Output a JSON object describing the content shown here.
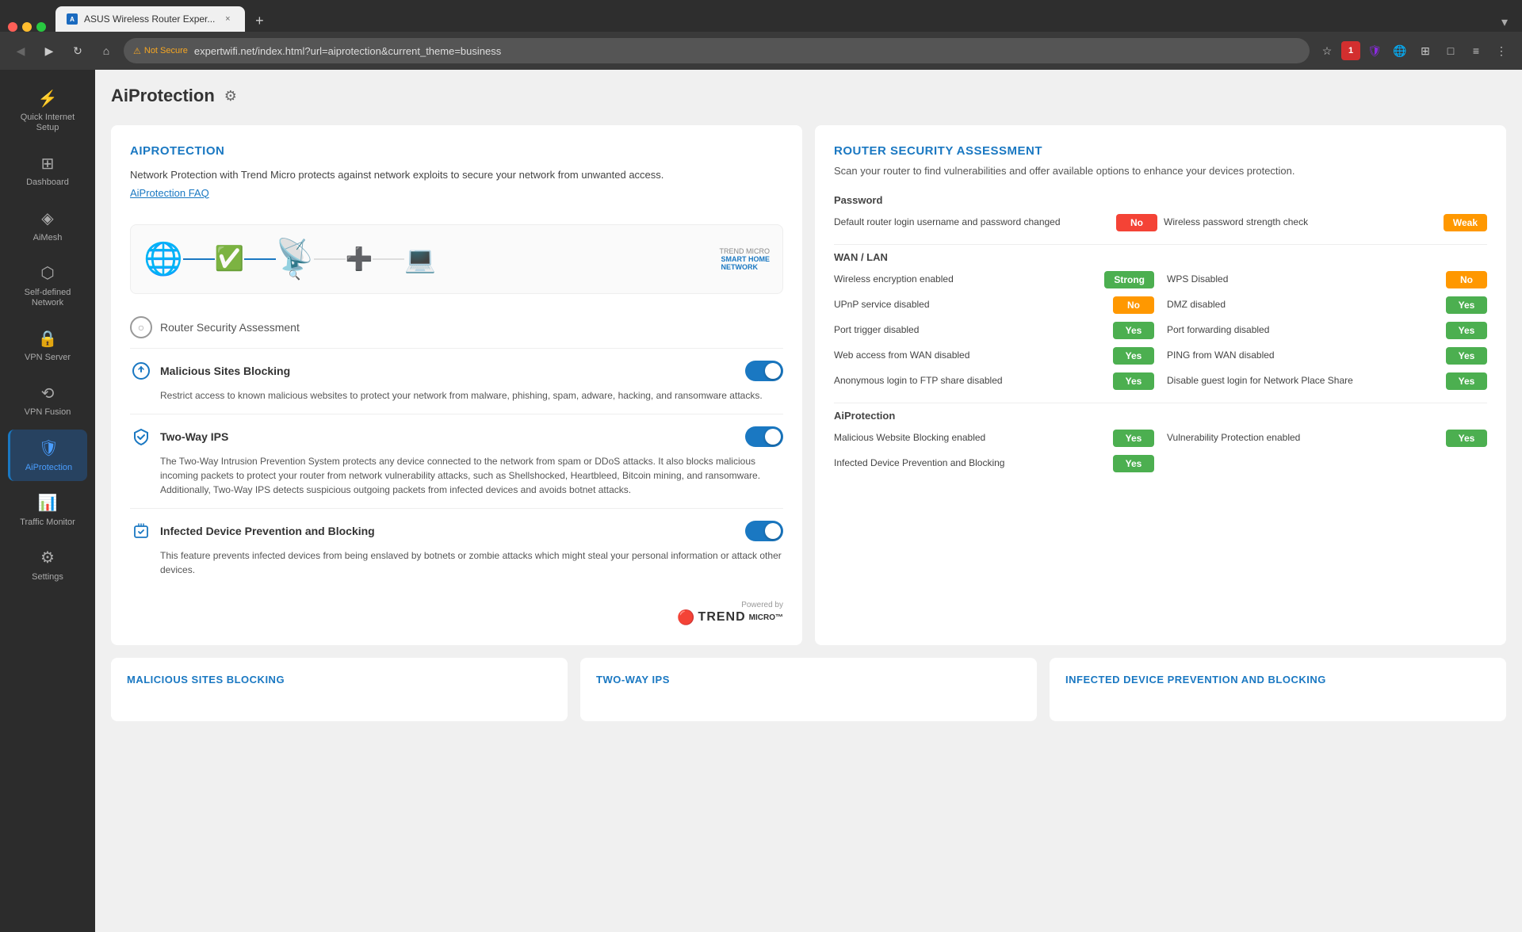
{
  "browser": {
    "tab_title": "ASUS Wireless Router Exper...",
    "url": "expertwifi.net/index.html?url=aiprotection&current_theme=business",
    "security_warning": "Not Secure"
  },
  "sidebar": {
    "items": [
      {
        "id": "quick-internet",
        "label": "Quick Internet\nSetup",
        "icon": "⚡"
      },
      {
        "id": "dashboard",
        "label": "Dashboard",
        "icon": "⊞"
      },
      {
        "id": "aimesh",
        "label": "AiMesh",
        "icon": "◈"
      },
      {
        "id": "self-defined-network",
        "label": "Self-defined\nNetwork",
        "icon": "⬡"
      },
      {
        "id": "vpn-server",
        "label": "VPN Server",
        "icon": "🔒"
      },
      {
        "id": "vpn-fusion",
        "label": "VPN Fusion",
        "icon": "⟲"
      },
      {
        "id": "aiprotection",
        "label": "AiProtection",
        "icon": "🛡"
      },
      {
        "id": "traffic-monitor",
        "label": "Traffic Monitor",
        "icon": "📊"
      },
      {
        "id": "settings",
        "label": "Settings",
        "icon": "⚙"
      }
    ]
  },
  "page": {
    "title": "AiProtection",
    "left_panel": {
      "section_title": "AIPROTECTION",
      "description": "Network Protection with Trend Micro protects against network exploits to secure your network from unwanted access.",
      "faq_link": "AiProtection FAQ",
      "nav_item": "Router Security Assessment",
      "features": [
        {
          "id": "malicious-sites",
          "title": "Malicious Sites Blocking",
          "enabled": true,
          "description": "Restrict access to known malicious websites to protect your network from malware, phishing, spam, adware, hacking, and ransomware attacks."
        },
        {
          "id": "two-way-ips",
          "title": "Two-Way IPS",
          "enabled": true,
          "description": "The Two-Way Intrusion Prevention System protects any device connected to the network from spam or DDoS attacks. It also blocks malicious incoming packets to protect your router from network vulnerability attacks, such as Shellshocked, Heartbleed, Bitcoin mining, and ransomware. Additionally, Two-Way IPS detects suspicious outgoing packets from infected devices and avoids botnet attacks."
        },
        {
          "id": "infected-device",
          "title": "Infected Device Prevention and Blocking",
          "enabled": true,
          "description": "This feature prevents infected devices from being enslaved by botnets or zombie attacks which might steal your personal information or attack other devices."
        }
      ],
      "powered_by": "Powered by"
    },
    "right_panel": {
      "title": "ROUTER SECURITY ASSESSMENT",
      "subtitle": "Scan your router to find vulnerabilities and offer available options to enhance your devices protection.",
      "sections": [
        {
          "title": "Password",
          "items": [
            {
              "label": "Default router login username and password changed",
              "status": "No",
              "status_type": "no"
            },
            {
              "label": "Wireless password strength check",
              "status": "Weak",
              "status_type": "weak"
            }
          ]
        },
        {
          "title": "WAN / LAN",
          "items_left": [
            {
              "label": "Wireless encryption enabled",
              "status": "Strong",
              "status_type": "strong"
            },
            {
              "label": "UPnP service disabled",
              "status": "No",
              "status_type": "no-orange"
            },
            {
              "label": "Port trigger disabled",
              "status": "Yes",
              "status_type": "yes"
            },
            {
              "label": "Web access from WAN disabled",
              "status": "Yes",
              "status_type": "yes"
            },
            {
              "label": "Anonymous login to FTP share disabled",
              "status": "Yes",
              "status_type": "yes"
            }
          ],
          "items_right": [
            {
              "label": "WPS Disabled",
              "status": "No",
              "status_type": "no-orange"
            },
            {
              "label": "DMZ disabled",
              "status": "Yes",
              "status_type": "yes"
            },
            {
              "label": "Port forwarding disabled",
              "status": "Yes",
              "status_type": "yes"
            },
            {
              "label": "PING from WAN disabled",
              "status": "Yes",
              "status_type": "yes"
            },
            {
              "label": "Disable guest login for Network Place Share",
              "status": "Yes",
              "status_type": "yes"
            }
          ]
        },
        {
          "title": "AiProtection",
          "items_left": [
            {
              "label": "Malicious Website Blocking enabled",
              "status": "Yes",
              "status_type": "yes"
            },
            {
              "label": "Infected Device Prevention and Blocking",
              "status": "Yes",
              "status_type": "yes"
            }
          ],
          "items_right": [
            {
              "label": "Vulnerability Protection enabled",
              "status": "Yes",
              "status_type": "yes"
            }
          ]
        }
      ]
    },
    "bottom_cards": [
      {
        "title": "MALICIOUS SITES BLOCKING"
      },
      {
        "title": "TWO-WAY IPS"
      },
      {
        "title": "INFECTED DEVICE PREVENTION AND BLOCKING"
      }
    ]
  }
}
